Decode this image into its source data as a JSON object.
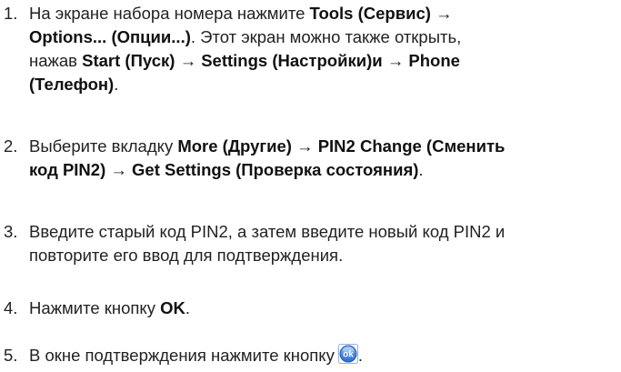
{
  "steps": [
    {
      "number": "1.",
      "lines": [
        [
          {
            "t": "На экране набора номера нажмите ",
            "b": false
          },
          {
            "t": "Tools (Сервис)",
            "b": true
          },
          {
            "t": " →",
            "b": false
          }
        ],
        [
          {
            "t": "Options... (Опции...)",
            "b": true
          },
          {
            "t": ". Этот экран можно также открыть,",
            "b": false
          }
        ],
        [
          {
            "t": "нажав ",
            "b": false
          },
          {
            "t": "Start (Пуск)",
            "b": true
          },
          {
            "t": " → ",
            "b": false
          },
          {
            "t": "Settings (Настройки)и",
            "b": true
          },
          {
            "t": " → ",
            "b": false
          },
          {
            "t": "Phone",
            "b": true
          }
        ],
        [
          {
            "t": "(Телефон)",
            "b": true
          },
          {
            "t": ".",
            "b": false
          }
        ]
      ]
    },
    {
      "number": "2.",
      "lines": [
        [
          {
            "t": "Выберите вкладку ",
            "b": false
          },
          {
            "t": "More (Другие)",
            "b": true
          },
          {
            "t": " → ",
            "b": false
          },
          {
            "t": "PIN2 Change (Сменить",
            "b": true
          }
        ],
        [
          {
            "t": "код PIN2)",
            "b": true
          },
          {
            "t": " → ",
            "b": false
          },
          {
            "t": "Get Settings (Проверка состояния)",
            "b": true
          },
          {
            "t": ".",
            "b": false
          }
        ]
      ]
    },
    {
      "number": "3.",
      "lines": [
        [
          {
            "t": "Введите старый код PIN2, а затем введите новый код PIN2 и",
            "b": false
          }
        ],
        [
          {
            "t": "повторите его ввод для подтверждения.",
            "b": false
          }
        ]
      ]
    },
    {
      "number": "4.",
      "lines": [
        [
          {
            "t": "Нажмите кнопку ",
            "b": false
          },
          {
            "t": "OK",
            "b": true
          },
          {
            "t": ".",
            "b": false
          }
        ]
      ]
    },
    {
      "number": "5.",
      "lines": [
        [
          {
            "t": "В окне подтверждения нажмите кнопку",
            "b": false
          }
        ]
      ],
      "icon": "ok-button-icon",
      "icon_label": "ok",
      "after_icon": "."
    }
  ],
  "colors": {
    "text": "#222222",
    "icon_blue": "#2f6fd0",
    "icon_light": "#9cc3f2"
  }
}
